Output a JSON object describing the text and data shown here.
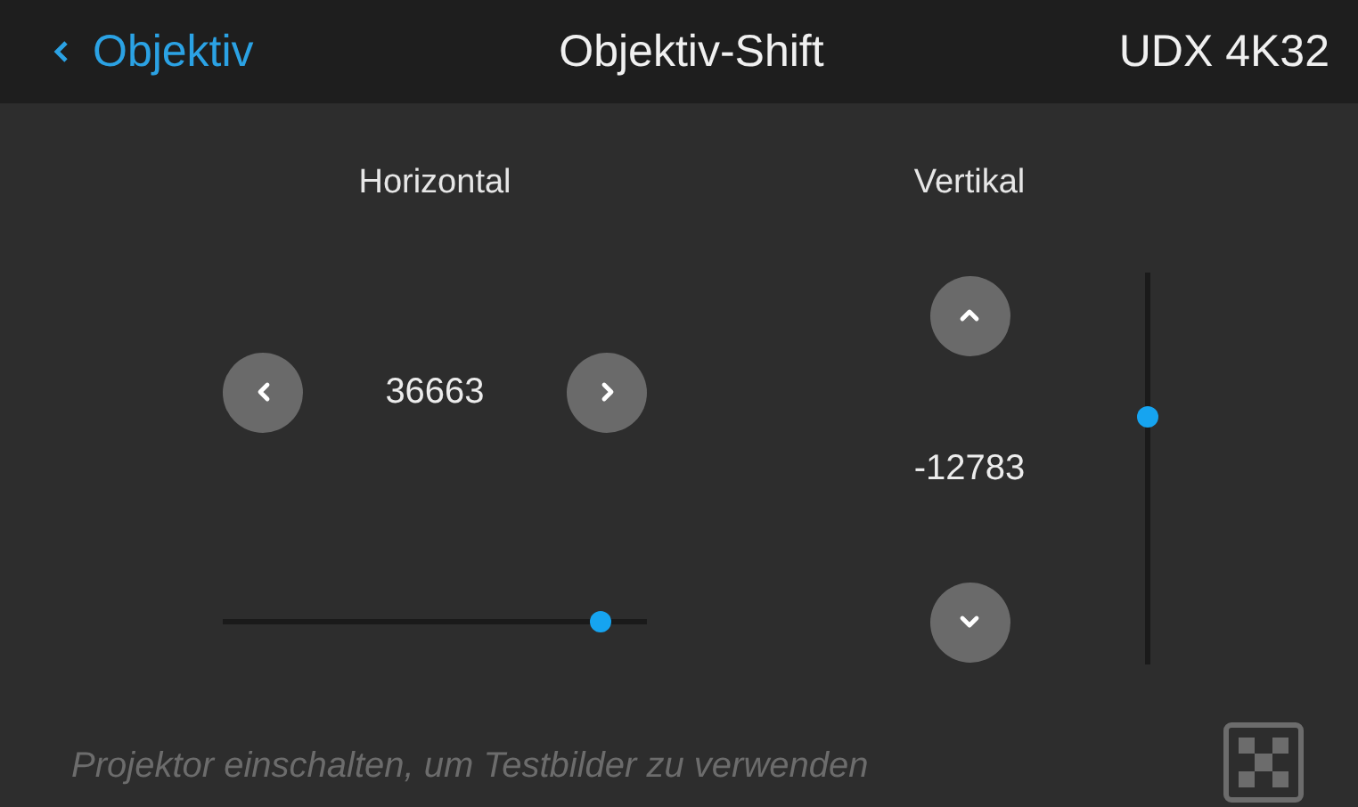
{
  "header": {
    "back_label": "Objektiv",
    "title": "Objektiv-Shift",
    "model": "UDX 4K32"
  },
  "horizontal": {
    "label": "Horizontal",
    "value": "36663",
    "level": 0.91
  },
  "vertical": {
    "label": "Vertikal",
    "value": "-12783",
    "level": 0.64
  },
  "footer": {
    "hint": "Projektor einschalten, um Testbilder zu verwenden",
    "test_pattern_disabled": true
  }
}
